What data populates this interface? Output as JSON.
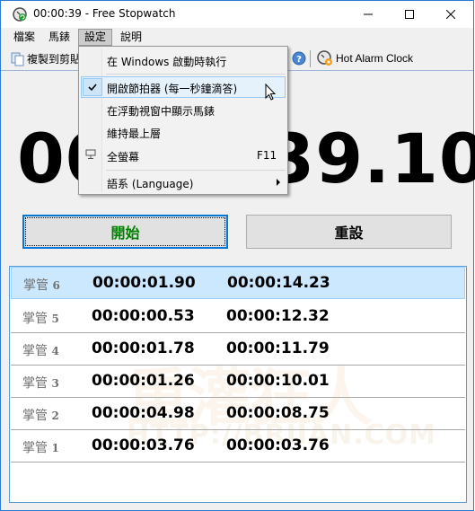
{
  "window": {
    "title": "00:00:39 - Free Stopwatch",
    "controls": {
      "minimize": "minimize",
      "maximize": "maximize",
      "close": "close"
    }
  },
  "menubar": {
    "items": [
      {
        "label": "檔案"
      },
      {
        "label": "馬錶"
      },
      {
        "label": "設定",
        "active": true
      },
      {
        "label": "說明"
      }
    ]
  },
  "toolbar": {
    "copy_label": "複製到剪貼",
    "help_icon": "help-icon",
    "alarm_label": "Hot Alarm Clock"
  },
  "settings_menu": {
    "items": [
      {
        "label": "在 Windows 啟動時執行"
      },
      {
        "label": "開啟節拍器 (每一秒鐘滴答)",
        "checked": true
      },
      {
        "label": "在浮動視窗中顯示馬錶"
      },
      {
        "label": "維持最上層"
      },
      {
        "label": "全螢幕",
        "shortcut": "F11",
        "icon": "fullscreen-icon"
      },
      {
        "label": "語系 (Language)",
        "submenu": true
      }
    ]
  },
  "display": {
    "time": "00:00:39.10"
  },
  "buttons": {
    "start": "開始",
    "reset": "重設"
  },
  "laps": {
    "label_prefix": "掌管",
    "rows": [
      {
        "num": "6",
        "split": "00:00:01.90",
        "total": "00:00:14.23",
        "selected": true
      },
      {
        "num": "5",
        "split": "00:00:00.53",
        "total": "00:00:12.32"
      },
      {
        "num": "4",
        "split": "00:00:01.78",
        "total": "00:00:11.79"
      },
      {
        "num": "3",
        "split": "00:00:01.26",
        "total": "00:00:10.01"
      },
      {
        "num": "2",
        "split": "00:00:04.98",
        "total": "00:00:08.75"
      },
      {
        "num": "1",
        "split": "00:00:03.76",
        "total": "00:00:03.76"
      }
    ]
  },
  "watermark": {
    "cjk": "重灌狂人",
    "url": "HTTP://BRIIAN.COM"
  },
  "colors": {
    "accent": "#0078d7",
    "start_text": "#008000",
    "selected_row": "#cce8ff",
    "window_border": "#2b7bd2"
  }
}
